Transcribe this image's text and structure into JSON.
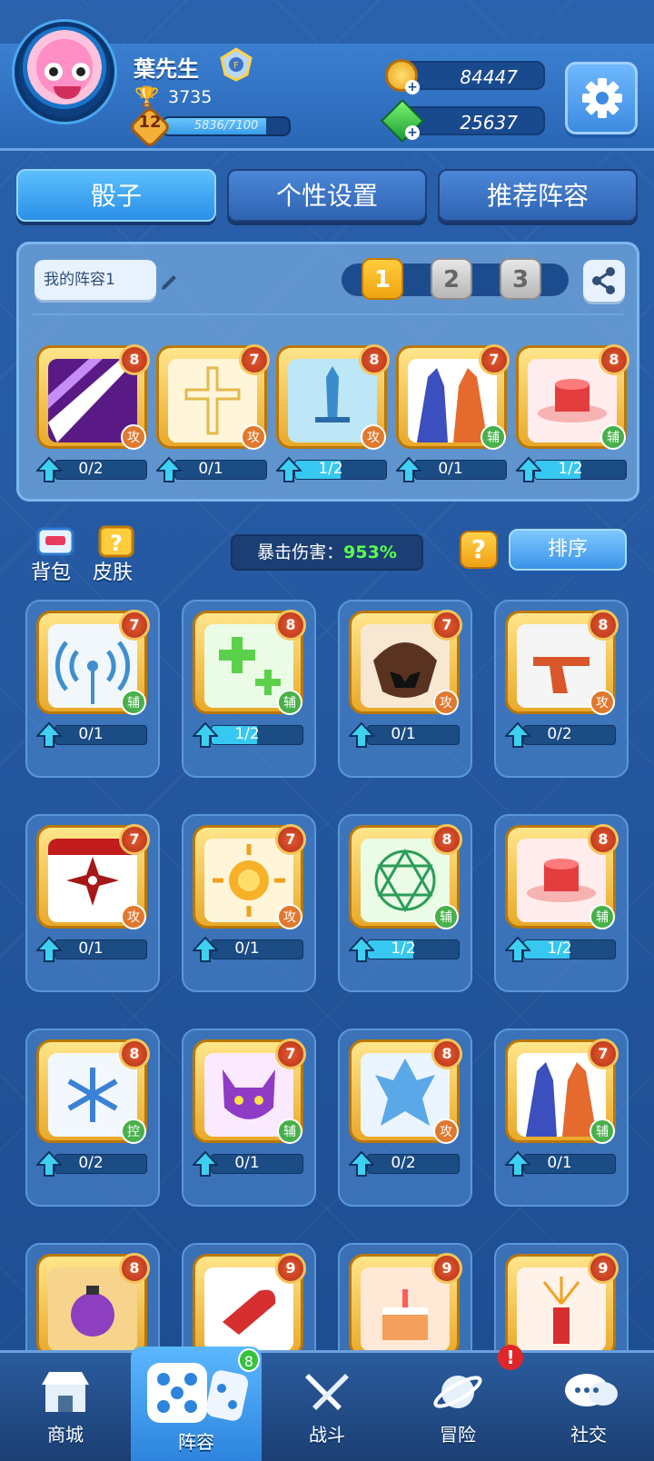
{
  "player": {
    "name": "葉先生",
    "trophies": "3735",
    "level": "12",
    "xp": "5836/7100",
    "xp_progress": 0.822,
    "coins": "84447",
    "gems": "25637"
  },
  "tabs": [
    "骰子",
    "个性设置",
    "推荐阵容"
  ],
  "active_tab": "骰子",
  "lineup": {
    "name": "我的阵容1",
    "decks": [
      "1",
      "2",
      "3"
    ],
    "active_deck": "1",
    "dice": [
      {
        "level": "8",
        "type": "攻",
        "progress": "0/2",
        "fill": 0.0,
        "icon": "purple-slash-icon"
      },
      {
        "level": "7",
        "type": "攻",
        "progress": "0/1",
        "fill": 0.0,
        "icon": "holy-cross-icon"
      },
      {
        "level": "8",
        "type": "攻",
        "progress": "1/2",
        "fill": 0.5,
        "icon": "sword-icon"
      },
      {
        "level": "7",
        "type": "辅",
        "progress": "0/1",
        "fill": 0.0,
        "icon": "mirror-figures-icon"
      },
      {
        "level": "8",
        "type": "辅",
        "progress": "1/2",
        "fill": 0.5,
        "icon": "red-drum-icon"
      }
    ]
  },
  "toolbar": {
    "bag_label": "背包",
    "skin_label": "皮肤",
    "crit_label": "暴击伤害：",
    "crit_value": "953%",
    "help_label": "?",
    "sort_label": "排序"
  },
  "collection": [
    {
      "level": "7",
      "type": "辅",
      "progress": "0/1",
      "fill": 0.0,
      "icon": "signal-icon"
    },
    {
      "level": "8",
      "type": "辅",
      "progress": "1/2",
      "fill": 0.5,
      "icon": "heal-cross-icon"
    },
    {
      "level": "7",
      "type": "攻",
      "progress": "0/1",
      "fill": 0.0,
      "icon": "beast-mask-icon"
    },
    {
      "level": "8",
      "type": "攻",
      "progress": "0/2",
      "fill": 0.0,
      "icon": "revolver-icon"
    },
    {
      "level": "7",
      "type": "攻",
      "progress": "0/1",
      "fill": 0.0,
      "icon": "shuriken-icon"
    },
    {
      "level": "7",
      "type": "攻",
      "progress": "0/1",
      "fill": 0.0,
      "icon": "sun-icon"
    },
    {
      "level": "8",
      "type": "辅",
      "progress": "1/2",
      "fill": 0.5,
      "icon": "magic-circle-icon"
    },
    {
      "level": "8",
      "type": "辅",
      "progress": "1/2",
      "fill": 0.5,
      "icon": "red-drum-icon"
    },
    {
      "level": "8",
      "type": "控",
      "progress": "0/2",
      "fill": 0.0,
      "icon": "snowflake-icon"
    },
    {
      "level": "7",
      "type": "辅",
      "progress": "0/1",
      "fill": 0.0,
      "icon": "purple-demon-icon"
    },
    {
      "level": "8",
      "type": "攻",
      "progress": "0/2",
      "fill": 0.0,
      "icon": "ice-spirit-icon"
    },
    {
      "level": "7",
      "type": "辅",
      "progress": "0/1",
      "fill": 0.0,
      "icon": "mirror-figures-icon"
    },
    {
      "level": "8",
      "type": "",
      "progress": "",
      "fill": 0.0,
      "icon": "grenade-icon"
    },
    {
      "level": "9",
      "type": "",
      "progress": "",
      "fill": 0.0,
      "icon": "bullet-icon"
    },
    {
      "level": "9",
      "type": "",
      "progress": "",
      "fill": 0.0,
      "icon": "cake-icon"
    },
    {
      "level": "9",
      "type": "",
      "progress": "",
      "fill": 0.0,
      "icon": "firework-icon"
    }
  ],
  "nav": {
    "items": [
      "商城",
      "阵容",
      "战斗",
      "冒险",
      "社交"
    ],
    "active": "阵容",
    "lineup_badge": "8",
    "adventure_alert": "!"
  },
  "colors": {
    "attack": "#e0782e",
    "support": "#47b04a",
    "crit_value": "#59ff4d",
    "active_deck": "#f0a412"
  }
}
